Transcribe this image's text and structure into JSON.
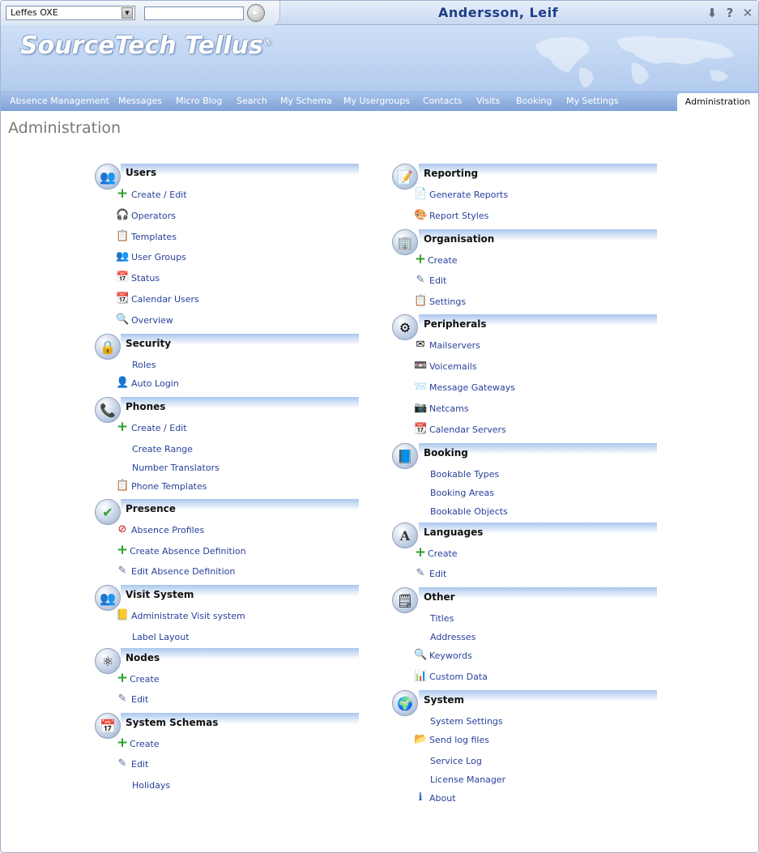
{
  "topbar": {
    "company": "Leffes OXE",
    "search_value": "",
    "user_name": "Andersson, Leif"
  },
  "banner": {
    "logo_text": "SourceTech Tellus",
    "logo_mark": "®"
  },
  "nav": {
    "items": [
      "Absence Management",
      "Messages",
      "Micro Blog",
      "Search",
      "My Schema",
      "My Usergroups",
      "Contacts",
      "Visits",
      "Booking",
      "My Settings"
    ],
    "active": "Administration"
  },
  "page": {
    "title": "Administration"
  },
  "left": {
    "users": {
      "title": "Users",
      "links": [
        "Create / Edit",
        "Operators",
        "Templates",
        "User Groups",
        "Status",
        "Calendar Users",
        "Overview"
      ]
    },
    "security": {
      "title": "Security",
      "links": [
        "Roles",
        "Auto Login"
      ]
    },
    "phones": {
      "title": "Phones",
      "links": [
        "Create / Edit",
        "Create Range",
        "Number Translators",
        "Phone Templates"
      ]
    },
    "presence": {
      "title": "Presence",
      "links": [
        "Absence Profiles",
        "Create Absence Definition",
        "Edit Absence Definition"
      ]
    },
    "visit": {
      "title": "Visit System",
      "links": [
        "Administrate Visit system",
        "Label Layout"
      ]
    },
    "nodes": {
      "title": "Nodes",
      "links": [
        "Create",
        "Edit"
      ]
    },
    "schemas": {
      "title": "System Schemas",
      "links": [
        "Create",
        "Edit",
        "Holidays"
      ]
    }
  },
  "right": {
    "reporting": {
      "title": "Reporting",
      "links": [
        "Generate Reports",
        "Report Styles"
      ]
    },
    "organisation": {
      "title": "Organisation",
      "links": [
        "Create",
        "Edit",
        "Settings"
      ]
    },
    "peripherals": {
      "title": "Peripherals",
      "links": [
        "Mailservers",
        "Voicemails",
        "Message Gateways",
        "Netcams",
        "Calendar Servers"
      ]
    },
    "booking": {
      "title": "Booking",
      "links": [
        "Bookable Types",
        "Booking Areas",
        "Bookable Objects"
      ]
    },
    "languages": {
      "title": "Languages",
      "links": [
        "Create",
        "Edit"
      ]
    },
    "other": {
      "title": "Other",
      "links": [
        "Titles",
        "Addresses",
        "Keywords",
        "Custom Data"
      ]
    },
    "system": {
      "title": "System",
      "links": [
        "System Settings",
        "Send log files",
        "Service Log",
        "License Manager",
        "About"
      ]
    }
  }
}
